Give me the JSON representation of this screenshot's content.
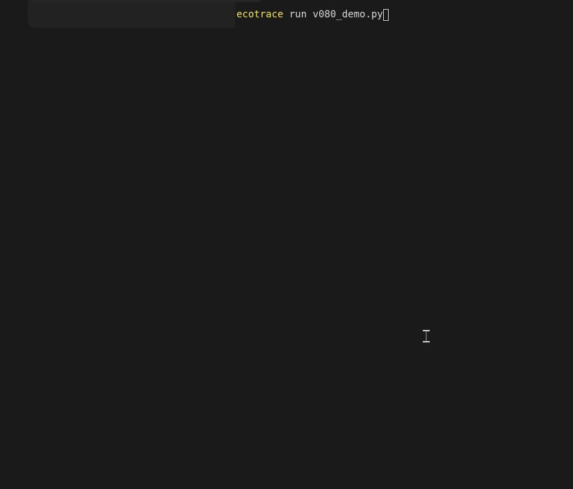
{
  "terminal": {
    "command": {
      "program": "ecotrace",
      "args": " run v080_demo.py"
    }
  },
  "colors": {
    "background": "#1a1a1a",
    "program_highlight": "#f2e35b",
    "text": "#d8d8d8"
  },
  "icons": {
    "cursor": "text-cursor-block",
    "mouse_pointer": "i-beam-icon"
  }
}
